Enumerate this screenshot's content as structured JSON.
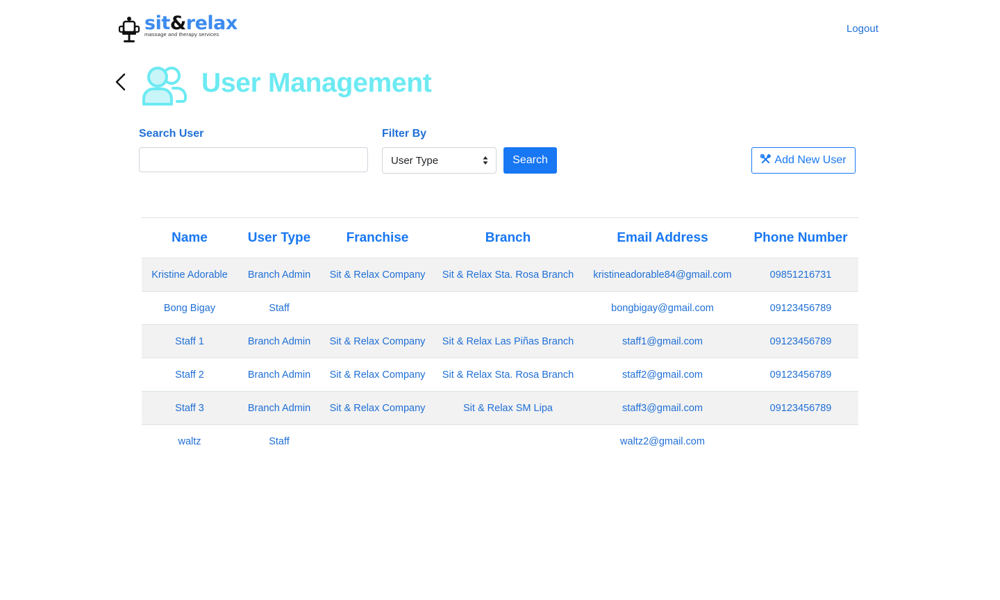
{
  "header": {
    "logo": {
      "name_part1": "sit",
      "name_amp": "&",
      "name_part2": "relax",
      "tagline": "massage and therapy services"
    },
    "logout_label": "Logout"
  },
  "page": {
    "title": "User Management",
    "back_icon": "chevron-left-icon",
    "title_icon": "users-icon"
  },
  "filters": {
    "search_label": "Search User",
    "search_value": "",
    "search_placeholder": "",
    "filter_label": "Filter By",
    "filter_selected": "User Type",
    "search_button": "Search",
    "add_button": "Add New User",
    "add_icon": "tools-icon"
  },
  "table": {
    "columns": [
      "Name",
      "User Type",
      "Franchise",
      "Branch",
      "Email Address",
      "Phone Number"
    ],
    "rows": [
      [
        "Kristine Adorable",
        "Branch Admin",
        "Sit & Relax Company",
        "Sit & Relax Sta. Rosa Branch",
        "kristineadorable84@gmail.com",
        "09851216731"
      ],
      [
        "Bong Bigay",
        "Staff",
        "",
        "",
        "bongbigay@gmail.com",
        "09123456789"
      ],
      [
        "Staff 1",
        "Branch Admin",
        "Sit & Relax Company",
        "Sit & Relax Las Piñas Branch",
        "staff1@gmail.com",
        "09123456789"
      ],
      [
        "Staff 2",
        "Branch Admin",
        "Sit & Relax Company",
        "Sit & Relax Sta. Rosa Branch",
        "staff2@gmail.com",
        "09123456789"
      ],
      [
        "Staff 3",
        "Branch Admin",
        "Sit & Relax Company",
        "Sit & Relax SM Lipa",
        "staff3@gmail.com",
        "09123456789"
      ],
      [
        "waltz",
        "Staff",
        "",
        "",
        "waltz2@gmail.com",
        ""
      ]
    ]
  },
  "colors": {
    "primary": "#1877f2",
    "title": "#6ceaf2",
    "text_link": "#1f6fd6",
    "stripe": "#f2f2f2"
  }
}
